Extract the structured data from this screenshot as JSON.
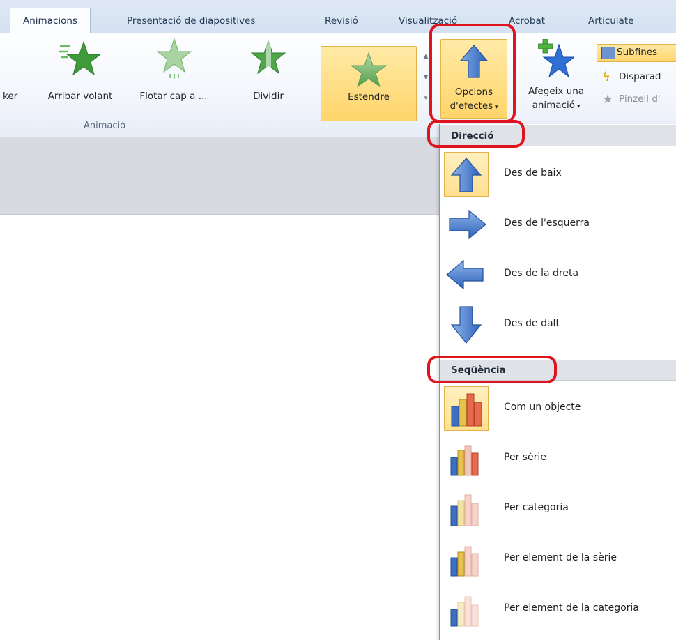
{
  "tabs": [
    {
      "label": "Animacions",
      "active": true
    },
    {
      "label": "Presentació de diapositives"
    },
    {
      "label": "Revisió"
    },
    {
      "label": "Visualització"
    },
    {
      "label": "Acrobat"
    },
    {
      "label": "Articulate"
    }
  ],
  "ribbon": {
    "group_label": "Animació",
    "buttons": [
      {
        "label": "ker"
      },
      {
        "label": "Arribar volant"
      },
      {
        "label": "Flotar cap a ..."
      },
      {
        "label": "Dividir"
      },
      {
        "label": "Estendre"
      }
    ],
    "effect_options": {
      "line1": "Opcions",
      "line2": "d'efectes"
    },
    "add_animation": {
      "line1": "Afegeix una",
      "line2": "animació"
    },
    "side": [
      {
        "label": "Subfines"
      },
      {
        "label": "Disparad"
      },
      {
        "label": "Pinzell d'"
      }
    ]
  },
  "menu": {
    "direction_header": "Direcció",
    "direction_items": [
      {
        "label": "Des de baix",
        "icon": "arrow-up-icon",
        "selected": true
      },
      {
        "label": "Des de l'esquerra",
        "icon": "arrow-right-icon"
      },
      {
        "label": "Des de la dreta",
        "icon": "arrow-left-icon"
      },
      {
        "label": "Des de dalt",
        "icon": "arrow-down-icon"
      }
    ],
    "sequence_header": "Seqüència",
    "sequence_items": [
      {
        "label": "Com un objecte",
        "icon": "chart-as-object-icon",
        "selected": true
      },
      {
        "label": "Per sèrie",
        "icon": "chart-by-series-icon"
      },
      {
        "label": "Per categoria",
        "icon": "chart-by-category-icon"
      },
      {
        "label": "Per element de la sèrie",
        "icon": "chart-by-series-element-icon"
      },
      {
        "label": "Per element de la categoria",
        "icon": "chart-by-category-element-icon"
      }
    ]
  },
  "colors": {
    "highlight": "#e0141e",
    "selected_bg": "#ffe08e",
    "star_green": "#3f9b3a",
    "arrow_blue": "#4b7fd0"
  }
}
